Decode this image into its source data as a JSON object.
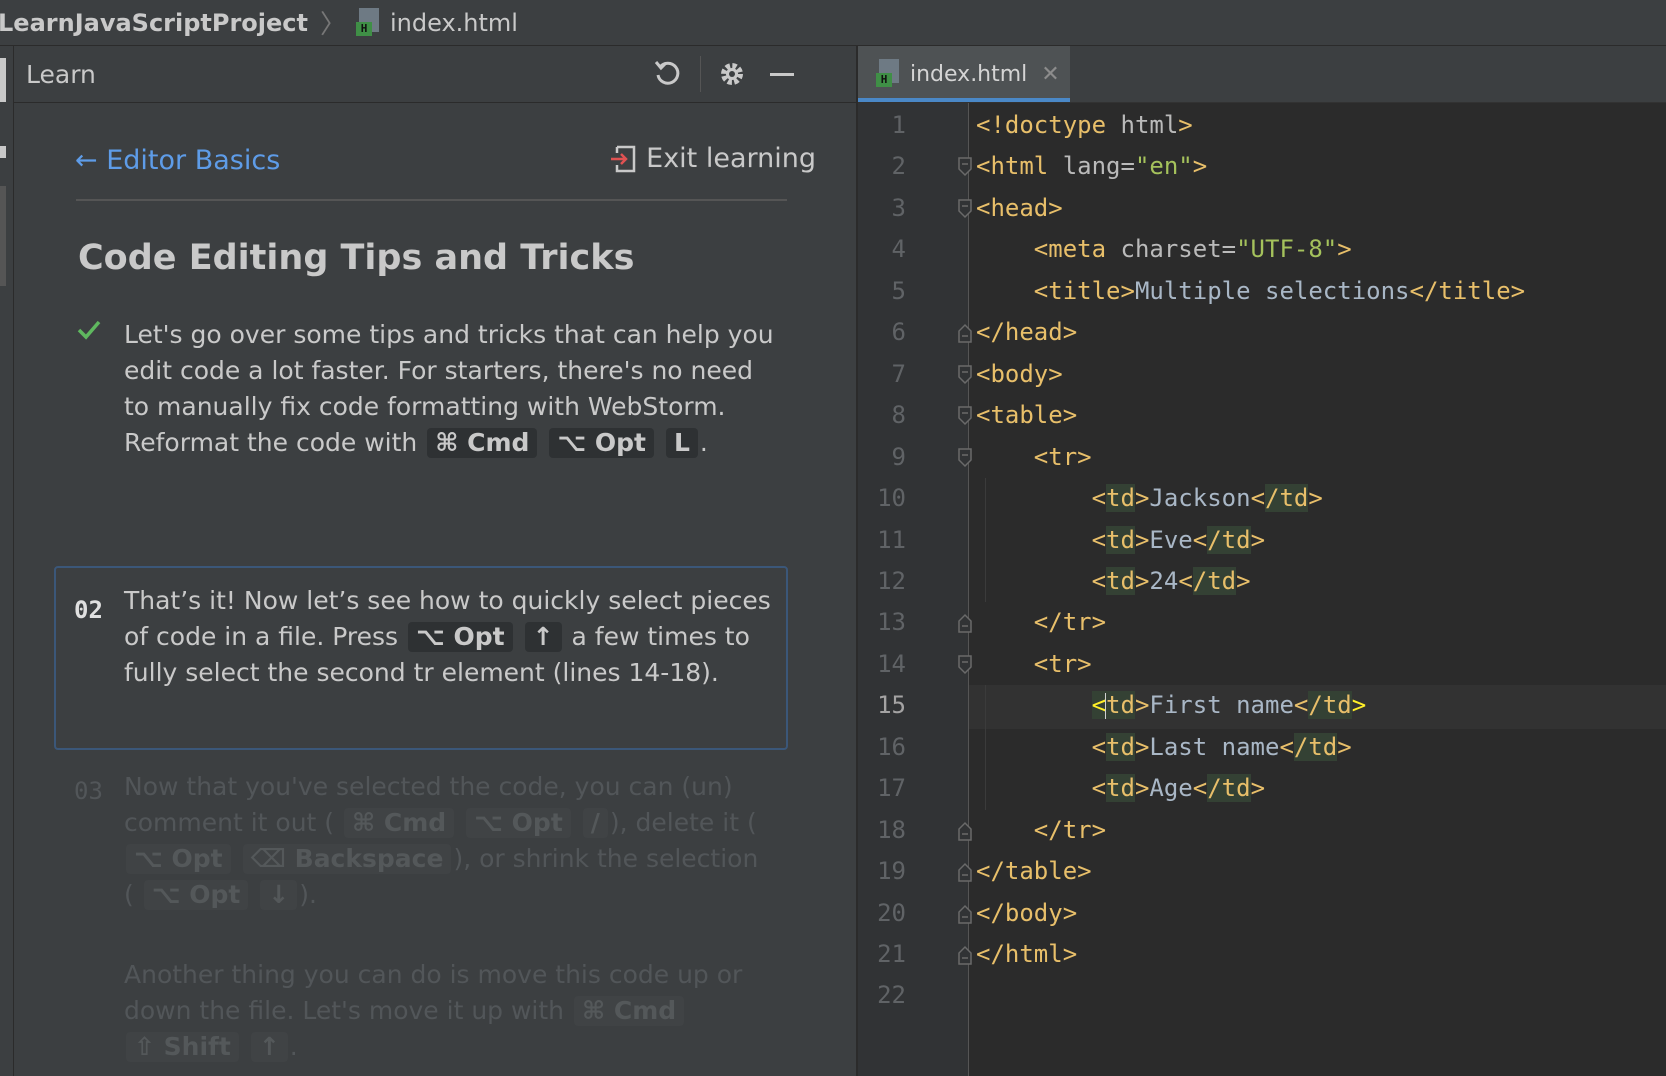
{
  "breadcrumb": {
    "project": "LearnJavaScriptProject",
    "file": "index.html"
  },
  "learn_panel": {
    "title": "Learn",
    "back_label": "Editor Basics",
    "exit_label": "Exit learning",
    "lesson_title": "Code Editing Tips and Tricks",
    "step1": {
      "text": "Let's go over some tips and tricks that can help you edit code a lot faster. For starters, there's no need to manually fix code formatting with WebStorm. Reformat the code with",
      "keys": [
        "⌘ Cmd",
        "⌥ Opt",
        "L"
      ],
      "end": "."
    },
    "step2": {
      "number": "02",
      "text_a": "That’s it! Now let’s see how to quickly select pieces of code in a file. Press",
      "keys": [
        "⌥ Opt",
        "↑"
      ],
      "text_b": "a few times to fully select the second tr element (lines 14-18)."
    },
    "step3": {
      "number": "03",
      "t1": "Now that you've selected the code, you can (un) comment it out (",
      "k1": [
        "⌘ Cmd",
        "⌥ Opt",
        "/"
      ],
      "t2": "), delete it (",
      "k2": [
        "⌥ Opt",
        "⌫ Backspace"
      ],
      "t3": "), or shrink the selection (",
      "k3": [
        "⌥ Opt",
        "↓"
      ],
      "t4": ").",
      "p2": "Another thing you can do is move this code up or down the file. Let's move it up with",
      "k4": [
        "⌘ Cmd",
        "⇧ Shift",
        "↑"
      ],
      "end": "."
    }
  },
  "editor": {
    "tab_label": "index.html",
    "current_line": 15,
    "line_numbers": [
      "1",
      "2",
      "3",
      "4",
      "5",
      "6",
      "7",
      "8",
      "9",
      "10",
      "11",
      "12",
      "13",
      "14",
      "15",
      "16",
      "17",
      "18",
      "19",
      "20",
      "21",
      "22"
    ],
    "lines": [
      "<!doctype html>",
      "<html lang=\"en\">",
      "<head>",
      "    <meta charset=\"UTF-8\">",
      "    <title>Multiple selections</title>",
      "</head>",
      "<body>",
      "<table>",
      "    <tr>",
      "        <td>Jackson</td>",
      "        <td>Eve</td>",
      "        <td>24</td>",
      "    </tr>",
      "    <tr>",
      "        <td>First name</td>",
      "        <td>Last name</td>",
      "        <td>Age</td>",
      "    </tr>",
      "</table>",
      "</body>",
      "</html>",
      ""
    ]
  },
  "colors": {
    "accent": "#4a88c7",
    "link": "#5e9ce8",
    "tag": "#e8bf6a",
    "attr_value": "#a5c25c",
    "check": "#5fb85f"
  }
}
